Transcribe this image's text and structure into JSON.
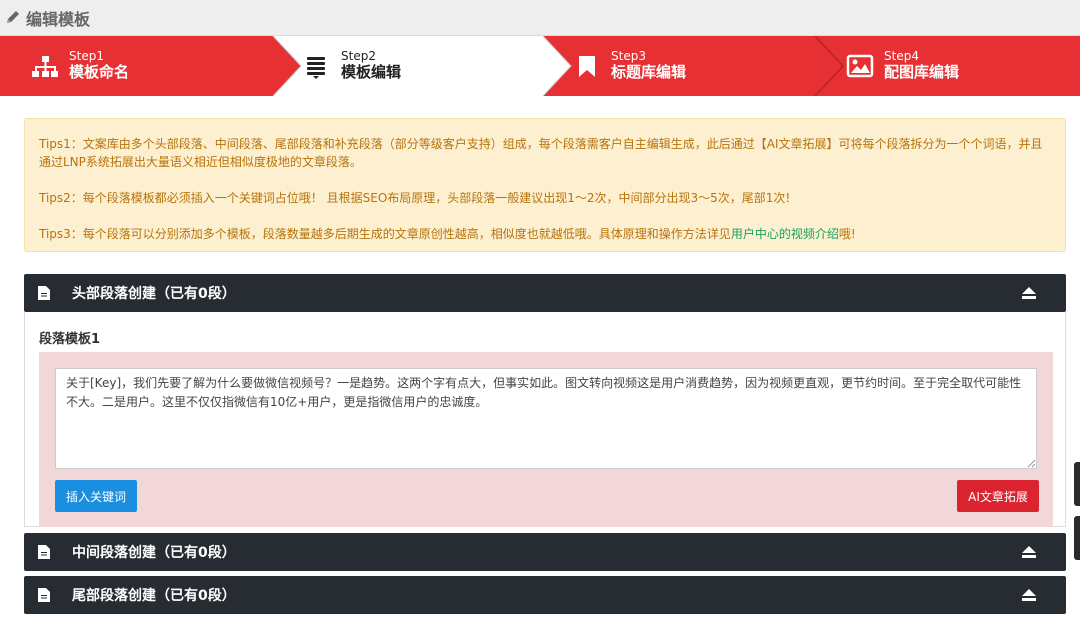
{
  "header": {
    "title": "编辑模板",
    "icon": "pencil-icon"
  },
  "steps": [
    {
      "num": "Step1",
      "name": "模板命名",
      "icon": "sitemap-icon",
      "state": "done"
    },
    {
      "num": "Step2",
      "name": "模板编辑",
      "icon": "list-icon",
      "state": "active"
    },
    {
      "num": "Step3",
      "name": "标题库编辑",
      "icon": "bookmark-icon",
      "state": "todo"
    },
    {
      "num": "Step4",
      "name": "配图库编辑",
      "icon": "image-icon",
      "state": "todo"
    }
  ],
  "tips": {
    "tip1": "Tips1：文案库由多个头部段落、中间段落、尾部段落和补充段落（部分等级客户支持）组成，每个段落需客户自主编辑生成，此后通过【AI文章拓展】可将每个段落拆分为一个个词语，并且通过LNP系统拓展出大量语义相近但相似度极地的文章段落。",
    "tip2": "Tips2：每个段落模板都必须插入一个关键词占位哦！ 且根据SEO布局原理，头部段落一般建议出现1～2次，中间部分出现3～5次，尾部1次!",
    "tip3_prefix": "Tips3：每个段落可以分别添加多个模板，段落数量越多后期生成的文章原创性越高，相似度也就越低哦。具体原理和操作方法详见",
    "tip3_link": "用户中心的视频介绍",
    "tip3_suffix": "哦!"
  },
  "sections": {
    "head": {
      "title": "头部段落创建（已有0段）",
      "icon": "document-icon",
      "toggle_icon": "eject-icon"
    },
    "middle": {
      "title": "中间段落创建（已有0段）",
      "icon": "document-icon",
      "toggle_icon": "eject-icon"
    },
    "tail": {
      "title": "尾部段落创建（已有0段）",
      "icon": "document-icon",
      "toggle_icon": "eject-icon"
    }
  },
  "panel": {
    "template_title": "段落模板1",
    "textarea_value": "关于[Key]，我们先要了解为什么要做微信视频号？一是趋势。这两个字有点大，但事实如此。图文转向视频这是用户消费趋势，因为视频更直观，更节约时间。至于完全取代可能性不大。二是用户。这里不仅仅指微信有10亿+用户，更是指微信用户的忠诚度。",
    "insert_keyword_label": "插入关键词",
    "ai_expand_label": "AI文章拓展"
  },
  "colors": {
    "step_red": "#e73033",
    "header_dark": "#272c33",
    "tips_bg": "#fdf0d0",
    "tips_text": "#b7730c",
    "link_green": "#1aa05a",
    "panel_pink": "#f2d7d8",
    "button_blue": "#1a8fe0",
    "button_red": "#dc2431"
  }
}
